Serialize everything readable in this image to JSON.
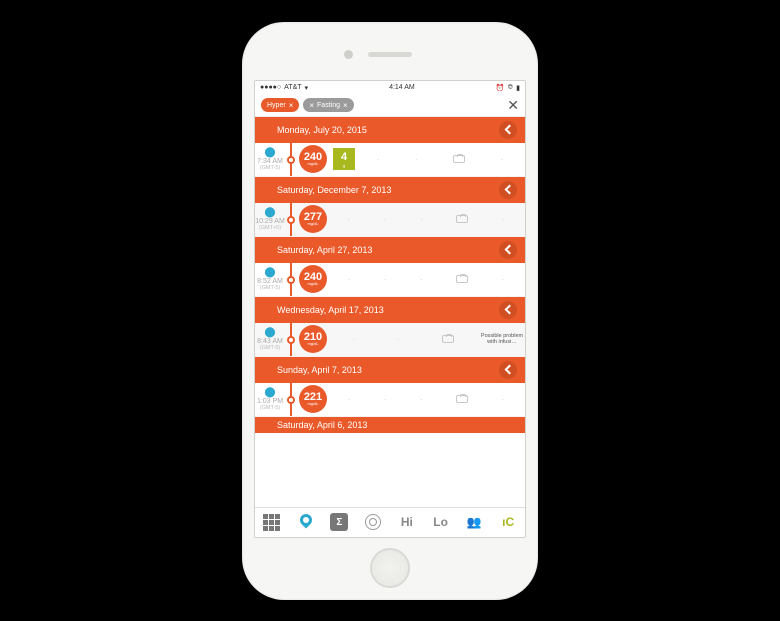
{
  "status": {
    "carrier": "AT&T",
    "signal": "●●●●○",
    "wifi": "⎋",
    "time": "4:14 AM",
    "bt": "⎋",
    "batt": "▮"
  },
  "filters": {
    "pills": [
      {
        "label": "Hyper",
        "style": "orange"
      },
      {
        "label": "Fasting",
        "style": "gray"
      }
    ],
    "close": "✕"
  },
  "days": [
    {
      "date": "Monday, July 20, 2015",
      "entries": [
        {
          "time": "7:34 AM",
          "tz": "(GMT-5)",
          "value": "240",
          "unit": "mg/dL",
          "carb": "4",
          "carb_unit": "g"
        }
      ]
    },
    {
      "date": "Saturday, December 7, 2013",
      "entries": [
        {
          "time": "10:29 AM",
          "tz": "(GMT+5)",
          "value": "277",
          "unit": "mg/dL"
        }
      ]
    },
    {
      "date": "Saturday, April 27, 2013",
      "entries": [
        {
          "time": "8:52 AM",
          "tz": "(GMT-5)",
          "value": "240",
          "unit": "mg/dL"
        }
      ]
    },
    {
      "date": "Wednesday, April 17, 2013",
      "entries": [
        {
          "time": "8:43 AM",
          "tz": "(GMT-5)",
          "value": "210",
          "unit": "mg/dL",
          "note": "Possible problem with infusi…"
        }
      ]
    },
    {
      "date": "Sunday, April 7, 2013",
      "entries": [
        {
          "time": "1:03 PM",
          "tz": "(GMT-5)",
          "value": "221",
          "unit": "mg/dL"
        }
      ]
    },
    {
      "date": "Saturday, April 6, 2013",
      "entries": []
    }
  ],
  "tabs": {
    "grid": "grid",
    "pin": "pin",
    "sigma": "Σ",
    "target": "target",
    "hi": "Hi",
    "lo": "Lo",
    "figure": "🏃",
    "cutlery": "🍴"
  },
  "dot": "·"
}
